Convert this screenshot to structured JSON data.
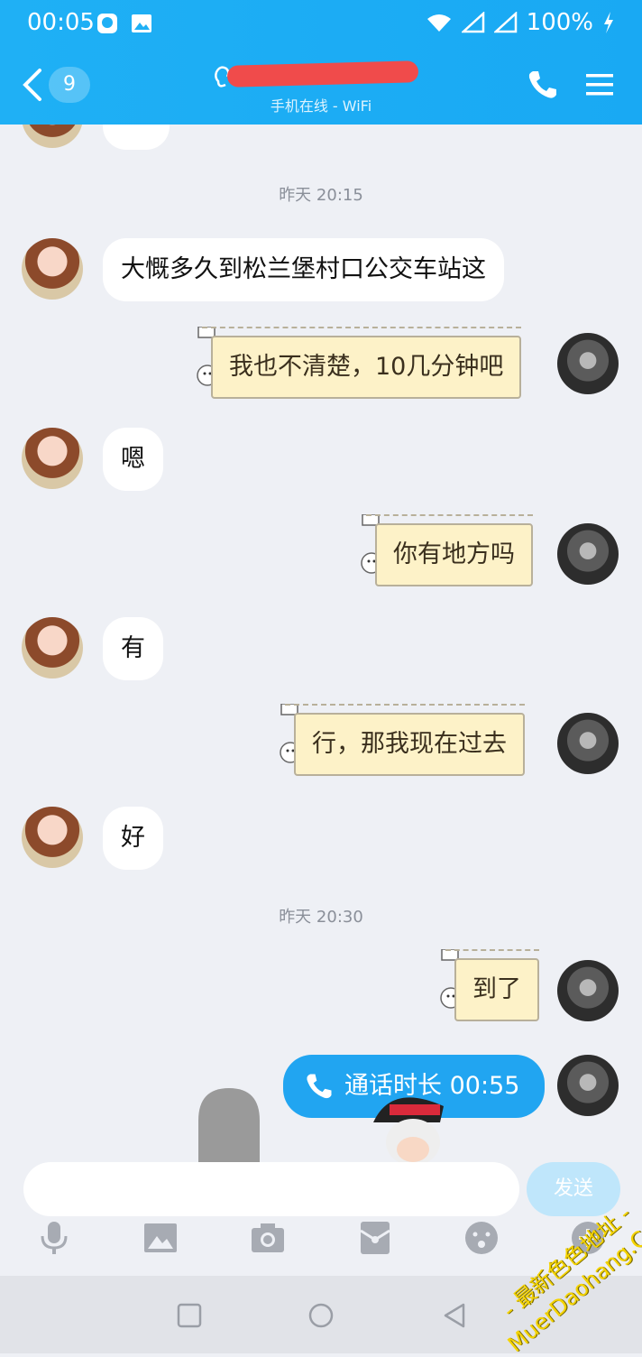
{
  "status_bar": {
    "time": "00:05",
    "battery": "100%"
  },
  "header": {
    "back_count": "9",
    "subtitle": "手机在线 - WiFi",
    "accent_color": "#1fb0f5"
  },
  "chat": {
    "timestamps": [
      "昨天 20:15",
      "昨天 20:30"
    ],
    "messages": [
      {
        "side": "left",
        "text": "大慨多久到松兰堡村口公交车站这"
      },
      {
        "side": "right",
        "text": "我也不清楚，10几分钟吧"
      },
      {
        "side": "left",
        "text": "嗯"
      },
      {
        "side": "right",
        "text": "你有地方吗"
      },
      {
        "side": "left",
        "text": "有"
      },
      {
        "side": "right",
        "text": "行，那我现在过去"
      },
      {
        "side": "left",
        "text": "好"
      },
      {
        "side": "right",
        "text": "到了"
      }
    ],
    "call": {
      "text": "通话时长 00:55"
    }
  },
  "input": {
    "placeholder": "",
    "send_label": "发送"
  },
  "toolbar": {
    "icons": [
      "microphone-icon",
      "image-icon",
      "camera-icon",
      "red-packet-icon",
      "emoji-icon",
      "plus-icon"
    ]
  },
  "watermark": {
    "line1": "- 最新色色地址 -",
    "line2": "MuerDaohang.Com"
  }
}
